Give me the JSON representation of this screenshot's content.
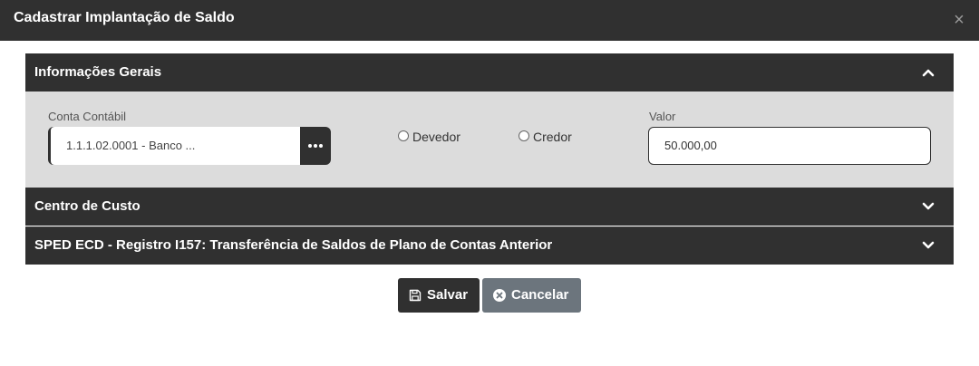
{
  "modal": {
    "title": "Cadastrar Implantação de Saldo",
    "close_label": "×"
  },
  "sections": {
    "informacoes_gerais": {
      "title": "Informações Gerais",
      "expanded": true,
      "conta_contabil": {
        "label": "Conta Contábil",
        "value": "1.1.1.02.0001 - Banco ..."
      },
      "natureza": {
        "options": [
          "Devedor",
          "Credor"
        ],
        "selected": null
      },
      "valor": {
        "label": "Valor",
        "value": "50.000,00"
      }
    },
    "centro_custo": {
      "title": "Centro de Custo",
      "expanded": false
    },
    "sped": {
      "title": "SPED ECD - Registro I157: Transferência de Saldos de Plano de Contas Anterior",
      "expanded": false
    }
  },
  "actions": {
    "save_label": "Salvar",
    "cancel_label": "Cancelar"
  },
  "colors": {
    "header_bg": "#303030",
    "body_bg": "#dcdcdc",
    "save_bg": "#303030",
    "cancel_bg": "#6c757d"
  }
}
